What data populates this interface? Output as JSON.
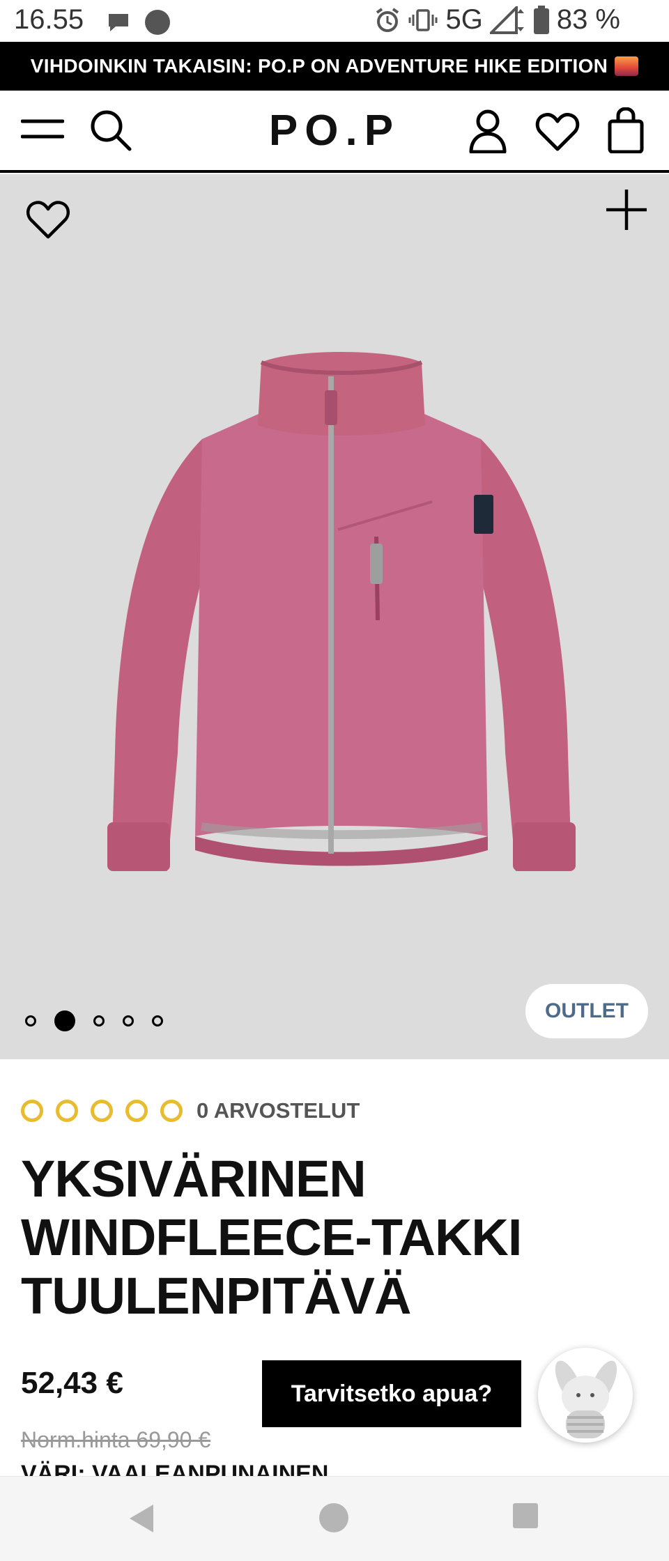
{
  "status_bar": {
    "time": "16.55",
    "network": "5G",
    "battery": "83 %"
  },
  "promo_banner": {
    "text": "VIHDOINKIN TAKAISIN: PO.P ON ADVENTURE HIKE EDITION"
  },
  "header": {
    "logo": "PO.P"
  },
  "gallery": {
    "badge": "OUTLET",
    "image_count": 5,
    "active_index": 1
  },
  "product": {
    "rating_stars_filled": 0,
    "rating_stars_total": 5,
    "rating_text": "0 ARVOSTELUT",
    "title_line1": "YKSIVÄRINEN",
    "title_line2": "WINDFLEECE-TAKKI",
    "title_line3": "TUULENPITÄVÄ",
    "price": "52,43 €",
    "old_price": "Norm.hinta 69,90 €",
    "color": "VÄRI: VAALEANPUNAINEN"
  },
  "help": {
    "label": "Tarvitsetko apua?"
  },
  "colors": {
    "accent_star": "#e9bb2e",
    "badge_text": "#4e6a8a",
    "jacket": "#c86a8b"
  },
  "icons": [
    "chat-bubble-icon",
    "circle-icon",
    "alarm-icon",
    "vibrate-icon",
    "signal-icon",
    "battery-icon",
    "menu-icon",
    "search-icon",
    "account-icon",
    "heart-icon",
    "bag-icon",
    "plus-icon",
    "back-icon",
    "home-icon",
    "recents-icon"
  ]
}
